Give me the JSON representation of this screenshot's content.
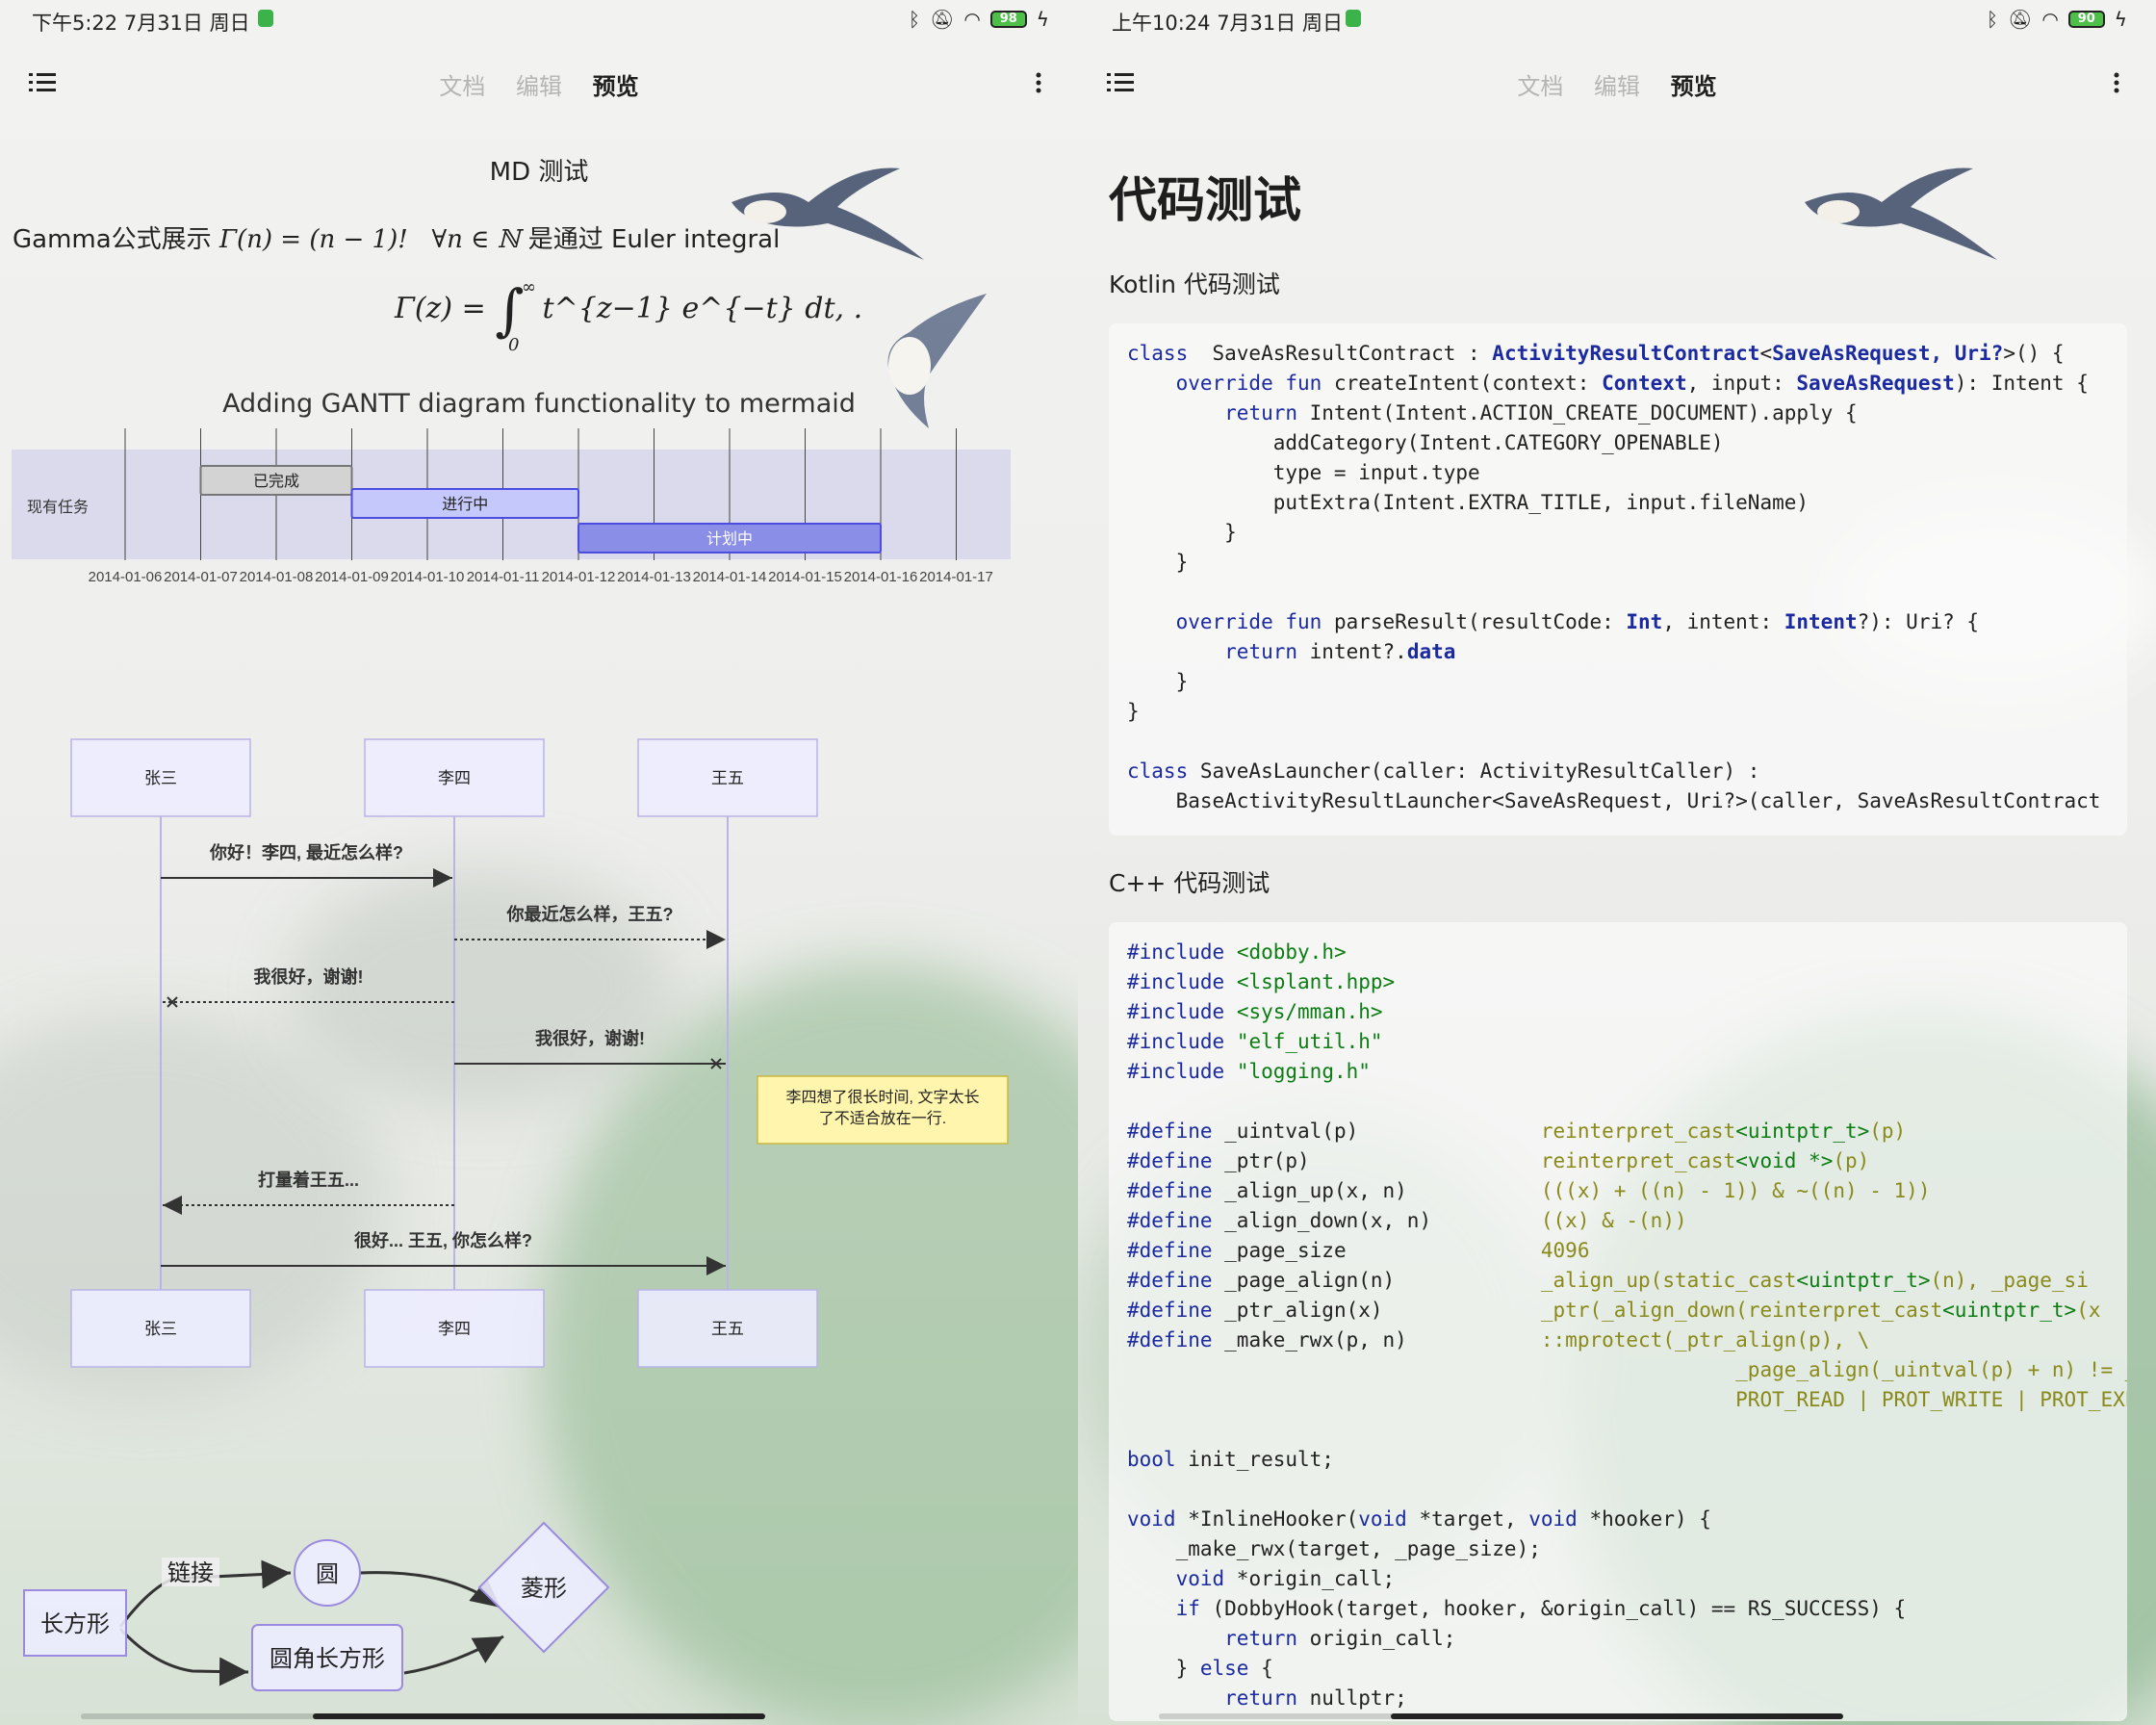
{
  "left": {
    "status": {
      "time": "下午5:22 7月31日 周日",
      "battery": "98"
    },
    "tabs": [
      "文档",
      "编辑",
      "预览"
    ],
    "heading": "MD 测试",
    "gamma": {
      "prefix": "Gamma公式展示 ",
      "formula": "Γ(n) = (n − 1)!",
      "forall": "∀n ∈ ℕ",
      "suffix": " 是通过 Euler integral",
      "integral_lhs": "Γ(z) = ",
      "integral_body": "t^{z−1} e^{−t} dt, .",
      "int_upper": "∞",
      "int_lower": "0"
    },
    "gantt": {
      "title": "Adding GANTT diagram functionality to mermaid",
      "section": "现有任务",
      "tasks": [
        {
          "label": "已完成",
          "status": "done",
          "start": 1,
          "end": 3
        },
        {
          "label": "进行中",
          "status": "active",
          "start": 3,
          "end": 6
        },
        {
          "label": "计划中",
          "status": "planned",
          "start": 6,
          "end": 10
        }
      ],
      "dates": [
        "2014-01-06",
        "2014-01-07",
        "2014-01-08",
        "2014-01-09",
        "2014-01-10",
        "2014-01-11",
        "2014-01-12",
        "2014-01-13",
        "2014-01-14",
        "2014-01-15",
        "2014-01-16",
        "2014-01-17"
      ]
    },
    "sequence": {
      "actors": [
        "张三",
        "李四",
        "王五"
      ],
      "messages": [
        {
          "from": 0,
          "to": 1,
          "text": "你好！李四, 最近怎么样?",
          "style": "solid-arrow"
        },
        {
          "from": 1,
          "to": 2,
          "text": "你最近怎么样，王五?",
          "style": "dotted-arrow"
        },
        {
          "from": 1,
          "to": 0,
          "text": "我很好，谢谢!",
          "style": "dotted-cross"
        },
        {
          "from": 1,
          "to": 2,
          "text": "我很好，谢谢!",
          "style": "solid-cross"
        },
        {
          "from": 1,
          "to": 0,
          "text": "打量着王五...",
          "style": "dotted-arrow"
        },
        {
          "from": 0,
          "to": 2,
          "text": "很好... 王五, 你怎么样?",
          "style": "solid-arrow"
        }
      ],
      "note": "李四想了很长时间, 文字太长了不适合放在一行."
    },
    "flowchart": {
      "rect": "长方形",
      "edge_label": "链接",
      "circle": "圆",
      "rounded": "圆角长方形",
      "rhombus": "菱形"
    }
  },
  "right": {
    "status": {
      "time": "上午10:24 7月31日 周日",
      "battery": "90"
    },
    "tabs": [
      "文档",
      "编辑",
      "预览"
    ],
    "heading": "代码测试",
    "kotlin_heading": "Kotlin 代码测试",
    "cpp_heading": "C++ 代码测试",
    "kotlin_lines": [
      [
        [
          "kw",
          "class"
        ],
        [
          "",
          "  SaveAsResultContract : "
        ],
        [
          "ty",
          "ActivityResultContract"
        ],
        [
          "",
          "<"
        ],
        [
          "ty",
          "SaveAsRequest, Uri?"
        ],
        [
          "",
          ">() {"
        ]
      ],
      [
        [
          "",
          "    "
        ],
        [
          "kw",
          "override fun"
        ],
        [
          "",
          " createIntent(context: "
        ],
        [
          "ty",
          "Context"
        ],
        [
          "",
          ", input: "
        ],
        [
          "ty",
          "SaveAsRequest"
        ],
        [
          "",
          "): Intent {"
        ]
      ],
      [
        [
          "",
          "        "
        ],
        [
          "kw",
          "return"
        ],
        [
          "",
          " Intent(Intent.ACTION_CREATE_DOCUMENT).apply {"
        ]
      ],
      [
        [
          "",
          "            addCategory(Intent.CATEGORY_OPENABLE)"
        ]
      ],
      [
        [
          "",
          "            type = input.type"
        ]
      ],
      [
        [
          "",
          "            putExtra(Intent.EXTRA_TITLE, input.fileName)"
        ]
      ],
      [
        [
          "",
          "        }"
        ]
      ],
      [
        [
          "",
          "    }"
        ]
      ],
      [
        [
          "",
          ""
        ]
      ],
      [
        [
          "",
          "    "
        ],
        [
          "kw",
          "override fun"
        ],
        [
          "",
          " parseResult(resultCode: "
        ],
        [
          "ty",
          "Int"
        ],
        [
          "",
          ", intent: "
        ],
        [
          "ty",
          "Intent"
        ],
        [
          "",
          "?): Uri? {"
        ]
      ],
      [
        [
          "",
          "        "
        ],
        [
          "kw",
          "return"
        ],
        [
          "",
          " intent?."
        ],
        [
          "ty",
          "data"
        ]
      ],
      [
        [
          "",
          "    }"
        ]
      ],
      [
        [
          "",
          "}"
        ]
      ],
      [
        [
          "",
          ""
        ]
      ],
      [
        [
          "kw",
          "class"
        ],
        [
          "",
          " SaveAsLauncher(caller: ActivityResultCaller) :"
        ]
      ],
      [
        [
          "",
          "    BaseActivityResultLauncher<SaveAsRequest, Uri?>(caller, SaveAsResultContract"
        ]
      ]
    ],
    "cpp_lines": [
      [
        [
          "dir",
          "#include"
        ],
        [
          "",
          " "
        ],
        [
          "str",
          "<dobby.h>"
        ]
      ],
      [
        [
          "dir",
          "#include"
        ],
        [
          "",
          " "
        ],
        [
          "str",
          "<lsplant.hpp>"
        ]
      ],
      [
        [
          "dir",
          "#include"
        ],
        [
          "",
          " "
        ],
        [
          "str",
          "<sys/mman.h>"
        ]
      ],
      [
        [
          "dir",
          "#include"
        ],
        [
          "",
          " "
        ],
        [
          "str",
          "\"elf_util.h\""
        ]
      ],
      [
        [
          "dir",
          "#include"
        ],
        [
          "",
          " "
        ],
        [
          "str",
          "\"logging.h\""
        ]
      ],
      [
        [
          "",
          ""
        ]
      ],
      [
        [
          "dir",
          "#define"
        ],
        [
          "",
          " _uintval(p)               "
        ],
        [
          "mac",
          "reinterpret_cast"
        ],
        [
          "str",
          "<uintptr_t>"
        ],
        [
          "mac",
          "(p)"
        ]
      ],
      [
        [
          "dir",
          "#define"
        ],
        [
          "",
          " _ptr(p)                   "
        ],
        [
          "mac",
          "reinterpret_cast"
        ],
        [
          "str",
          "<void *>"
        ],
        [
          "mac",
          "(p)"
        ]
      ],
      [
        [
          "dir",
          "#define"
        ],
        [
          "",
          " _align_up(x, n)           "
        ],
        [
          "mac",
          "(((x) + ((n) - 1)) & ~((n) - 1))"
        ]
      ],
      [
        [
          "dir",
          "#define"
        ],
        [
          "",
          " _align_down(x, n)         "
        ],
        [
          "mac",
          "((x) & -(n))"
        ]
      ],
      [
        [
          "dir",
          "#define"
        ],
        [
          "",
          " _page_size                "
        ],
        [
          "mac",
          "4096"
        ]
      ],
      [
        [
          "dir",
          "#define"
        ],
        [
          "",
          " _page_align(n)            "
        ],
        [
          "mac",
          "_align_up(static_cast"
        ],
        [
          "str",
          "<uintptr_t>"
        ],
        [
          "mac",
          "(n), _page_si"
        ]
      ],
      [
        [
          "dir",
          "#define"
        ],
        [
          "",
          " _ptr_align(x)             "
        ],
        [
          "mac",
          "_ptr(_align_down(reinterpret_cast"
        ],
        [
          "str",
          "<uintptr_t>"
        ],
        [
          "mac",
          "(x"
        ]
      ],
      [
        [
          "dir",
          "#define"
        ],
        [
          "",
          " _make_rwx(p, n)           "
        ],
        [
          "mac",
          "::mprotect(_ptr_align(p), \\"
        ]
      ],
      [
        [
          "",
          "                                                  "
        ],
        [
          "mac",
          "_page_align(_uintval(p) + n) != _"
        ]
      ],
      [
        [
          "",
          "                                                  "
        ],
        [
          "mac",
          "PROT_READ | PROT_WRITE | PROT_EXE"
        ]
      ],
      [
        [
          "",
          ""
        ]
      ],
      [
        [
          "kw",
          "bool"
        ],
        [
          "",
          " init_result;"
        ]
      ],
      [
        [
          "",
          ""
        ]
      ],
      [
        [
          "kw",
          "void"
        ],
        [
          "",
          " *InlineHooker("
        ],
        [
          "kw",
          "void"
        ],
        [
          "",
          " *target, "
        ],
        [
          "kw",
          "void"
        ],
        [
          "",
          " *hooker) {"
        ]
      ],
      [
        [
          "",
          "    _make_rwx(target, _page_size);"
        ]
      ],
      [
        [
          "",
          "    "
        ],
        [
          "kw",
          "void"
        ],
        [
          "",
          " *origin_call;"
        ]
      ],
      [
        [
          "",
          "    "
        ],
        [
          "kw",
          "if"
        ],
        [
          "",
          " (DobbyHook(target, hooker, &origin_call) == RS_SUCCESS) {"
        ]
      ],
      [
        [
          "",
          "        "
        ],
        [
          "kw",
          "return"
        ],
        [
          "",
          " origin_call;"
        ]
      ],
      [
        [
          "",
          "    } "
        ],
        [
          "kw",
          "else"
        ],
        [
          "",
          " {"
        ]
      ],
      [
        [
          "",
          "        "
        ],
        [
          "kw",
          "return"
        ],
        [
          "",
          " nullptr;"
        ]
      ]
    ]
  }
}
